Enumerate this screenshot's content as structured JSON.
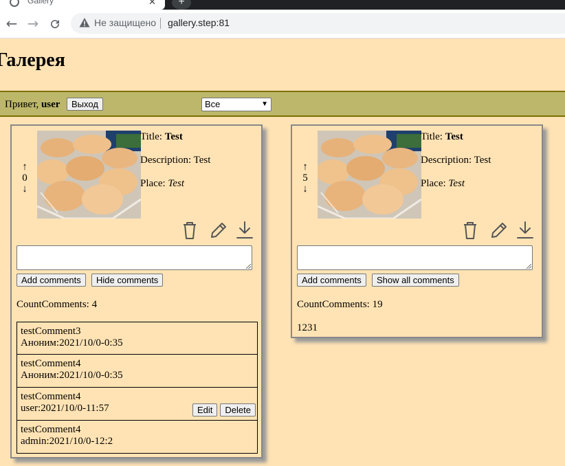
{
  "browser": {
    "tab_title": "Gallery",
    "security_label": "Не защищено",
    "url": "gallery.step:81"
  },
  "page": {
    "title": "Галерея"
  },
  "userbar": {
    "greeting": "Привет,",
    "username": "user",
    "logout_label": "Выход",
    "filter_selected": "Все"
  },
  "labels": {
    "title": "Title:",
    "description": "Description:",
    "place": "Place:",
    "add_comments": "Add comments",
    "hide_comments": "Hide comments",
    "show_all_comments": "Show all comments",
    "edit": "Edit",
    "delete": "Delete"
  },
  "cards": [
    {
      "votes": "0",
      "title": "Test",
      "description": "Test",
      "place": "Test",
      "comment_input": "",
      "count_comments": "CountComments: 4",
      "comments": [
        {
          "text": "testComment3",
          "meta": "Аноним:2021/10/0-0:35"
        },
        {
          "text": "testComment4",
          "meta": "Аноним:2021/10/0-0:35"
        },
        {
          "text": "testComment4",
          "meta": "user:2021/10/0-11:57"
        },
        {
          "text": "testComment4",
          "meta": "admin:2021/10/0-12:2"
        }
      ]
    },
    {
      "votes": "5",
      "title": "Test",
      "description": "Test",
      "place": "Test",
      "comment_input": "",
      "count_comments": "CountComments: 19",
      "last_comment": "1231"
    }
  ],
  "icons": [
    "trash-icon",
    "pencil-icon",
    "download-icon",
    "warning-icon",
    "back-icon",
    "forward-icon",
    "reload-icon"
  ]
}
